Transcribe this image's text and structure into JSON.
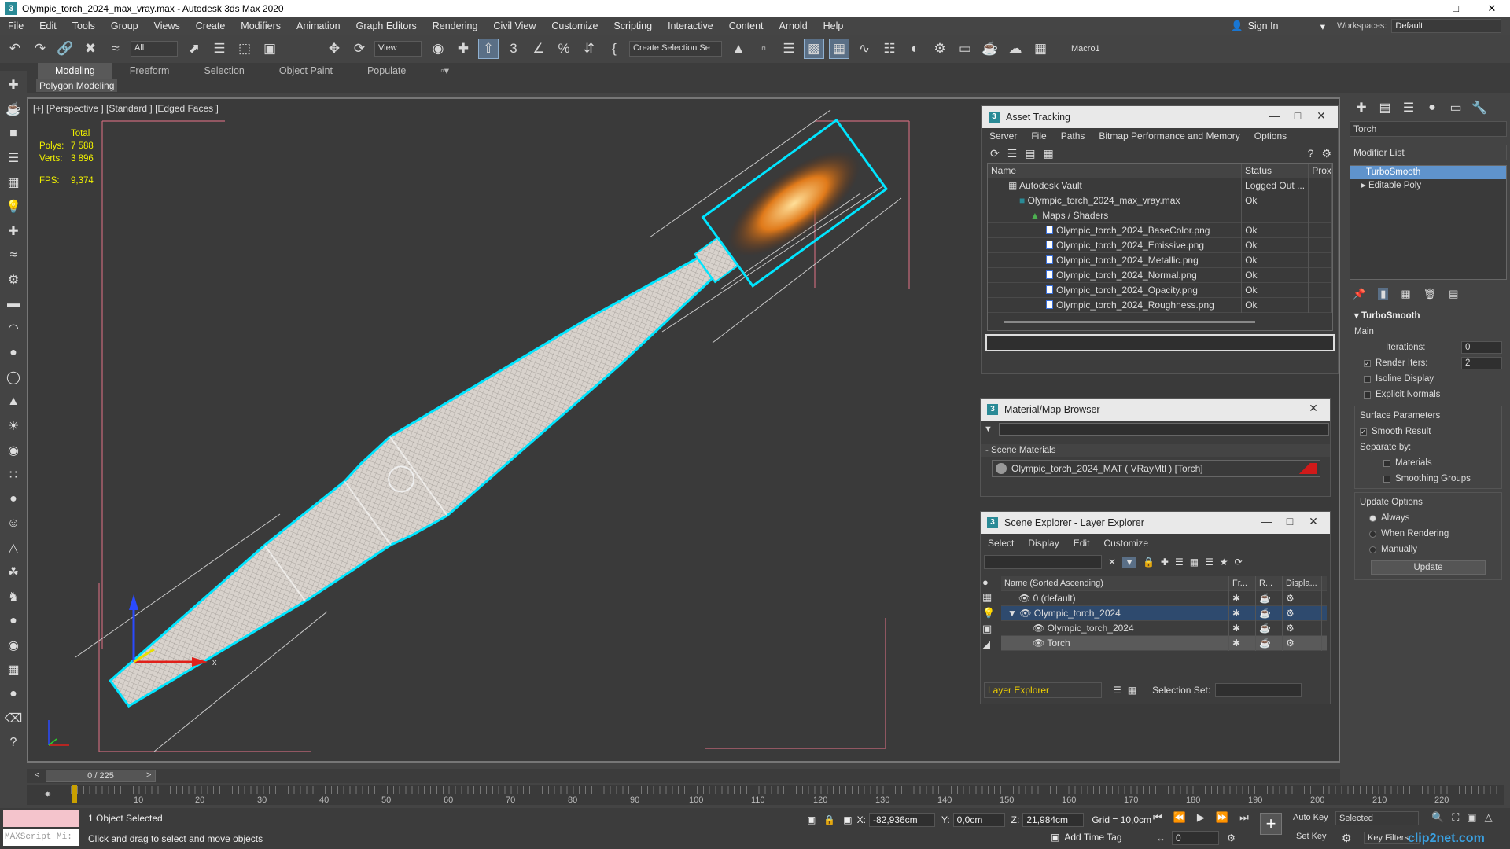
{
  "window": {
    "title": "Olympic_torch_2024_max_vray.max - Autodesk 3ds Max 2020",
    "controls": [
      "—",
      "□",
      "✕"
    ]
  },
  "menu": [
    "File",
    "Edit",
    "Tools",
    "Group",
    "Views",
    "Create",
    "Modifiers",
    "Animation",
    "Graph Editors",
    "Rendering",
    "Civil View",
    "Customize",
    "Scripting",
    "Interactive",
    "Content",
    "Arnold",
    "Help"
  ],
  "account": {
    "sign_in": "Sign In",
    "workspaces_label": "Workspaces:",
    "workspace": "Default"
  },
  "toolbar": {
    "filter": "All",
    "view": "View",
    "create_selection": "Create Selection Se",
    "macro": "Macro1"
  },
  "ribbon": {
    "tabs": [
      "Modeling",
      "Freeform",
      "Selection",
      "Object Paint",
      "Populate"
    ],
    "sub": "Polygon Modeling"
  },
  "viewport": {
    "label": "[+] [Perspective ] [Standard ] [Edged Faces ]",
    "stats": {
      "total": "Total",
      "polys_label": "Polys:",
      "polys": "7 588",
      "verts_label": "Verts:",
      "verts": "3 896",
      "fps_label": "FPS:",
      "fps": "9,374"
    }
  },
  "asset_tracking": {
    "title": "Asset Tracking",
    "menu": [
      "Server",
      "File",
      "Paths",
      "Bitmap Performance and Memory",
      "Options"
    ],
    "columns": [
      "Name",
      "Status",
      "Proxy"
    ],
    "rows": [
      {
        "name": "Autodesk Vault",
        "status": "Logged Out ..."
      },
      {
        "name": "Olympic_torch_2024_max_vray.max",
        "status": "Ok"
      },
      {
        "name": "Maps / Shaders",
        "status": ""
      },
      {
        "name": "Olympic_torch_2024_BaseColor.png",
        "status": "Ok"
      },
      {
        "name": "Olympic_torch_2024_Emissive.png",
        "status": "Ok"
      },
      {
        "name": "Olympic_torch_2024_Metallic.png",
        "status": "Ok"
      },
      {
        "name": "Olympic_torch_2024_Normal.png",
        "status": "Ok"
      },
      {
        "name": "Olympic_torch_2024_Opacity.png",
        "status": "Ok"
      },
      {
        "name": "Olympic_torch_2024_Roughness.png",
        "status": "Ok"
      }
    ]
  },
  "material_browser": {
    "title": "Material/Map Browser",
    "group": "- Scene Materials",
    "material": "Olympic_torch_2024_MAT ( VRayMtl ) [Torch]"
  },
  "scene_explorer": {
    "title": "Scene Explorer - Layer Explorer",
    "menu": [
      "Select",
      "Display",
      "Edit",
      "Customize"
    ],
    "columns": [
      "Name (Sorted Ascending)",
      "Fr...",
      "R...",
      "Displa..."
    ],
    "rows": [
      "0 (default)",
      "Olympic_torch_2024",
      "Olympic_torch_2024",
      "Torch"
    ],
    "footer": "Layer Explorer",
    "selection_set_label": "Selection Set:"
  },
  "command_panel": {
    "object_name": "Torch",
    "modifier_list": "Modifier List",
    "stack": [
      "TurboSmooth",
      "Editable Poly"
    ],
    "turbosmooth": {
      "title": "TurboSmooth",
      "main": "Main",
      "iterations_label": "Iterations:",
      "iterations": "0",
      "render_iters_label": "Render Iters:",
      "render_iters": "2",
      "isoline": "Isoline Display",
      "explicit": "Explicit Normals",
      "surface": "Surface Parameters",
      "smooth": "Smooth Result",
      "separate": "Separate by:",
      "materials": "Materials",
      "smoothing": "Smoothing Groups",
      "update_options": "Update Options",
      "always": "Always",
      "when_rendering": "When Rendering",
      "manually": "Manually",
      "update": "Update"
    }
  },
  "timeline": {
    "slider": "0 / 225",
    "ticks": [
      "10",
      "20",
      "30",
      "40",
      "50",
      "60",
      "70",
      "80",
      "90",
      "100",
      "110",
      "120",
      "130",
      "140",
      "150",
      "160",
      "170",
      "180",
      "190",
      "200",
      "210",
      "220"
    ]
  },
  "status": {
    "maxscript": "MAXScript Mi:",
    "selected": "1 Object Selected",
    "prompt": "Click and drag to select and move objects",
    "x_label": "X:",
    "x": "-82,936cm",
    "y_label": "Y:",
    "y": "0,0cm",
    "z_label": "Z:",
    "z": "21,984cm",
    "grid": "Grid = 10,0cm",
    "add_time_tag": "Add Time Tag",
    "auto_key": "Auto Key",
    "set_key": "Set Key",
    "selected_mode": "Selected",
    "key_filters": "Key Filters...",
    "frame": "0",
    "watermark": "clip2net.com"
  }
}
